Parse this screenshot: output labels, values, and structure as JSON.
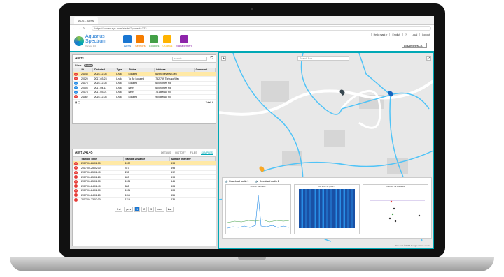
{
  "browser": {
    "tab_title": "AQS - Alerts",
    "url": "https://aquas-sys.com/alerts/?project=123"
  },
  "app": {
    "logo_line1": "Aquarius",
    "logo_line2": "Spectrum",
    "logo_sub": "Version 1.0",
    "modules": [
      {
        "label": "Alerts",
        "color": "#1976d2"
      },
      {
        "label": "Sensors",
        "color": "#f57c00"
      },
      {
        "label": "Couples",
        "color": "#43a047"
      },
      {
        "label": "Quarius",
        "color": "#ffb300"
      },
      {
        "label": "Management",
        "color": "#8e24aa"
      }
    ],
    "top_links": [
      "Hello mark_r",
      "English",
      "?",
      "Local",
      "Logout"
    ],
    "city": "LosAngelesCA"
  },
  "alerts_panel": {
    "title": "Alerts",
    "search_placeholder": "search",
    "filters_label": "Filters",
    "filter_pill": "Active",
    "columns": [
      "ID",
      "Detected",
      "Type",
      "Status",
      "Address",
      "Comment"
    ],
    "rows": [
      {
        "icon": "A",
        "color": "#e53935",
        "id": "24145",
        "detected": "2016-12-08",
        "type": "Leak",
        "status": "Located",
        "address": "619 N Beverly Glen"
      },
      {
        "icon": "A",
        "color": "#e53935",
        "id": "20020",
        "detected": "2017-03-23",
        "type": "Leak",
        "status": "To Be Located",
        "address": "752 759 Torbuso Way"
      },
      {
        "icon": "A",
        "color": "#1e88e5",
        "id": "24176",
        "detected": "2016-12-08",
        "type": "Leak",
        "status": "Located",
        "address": "600 Nimes Rd"
      },
      {
        "icon": "A",
        "color": "#1e88e5",
        "id": "20006",
        "detected": "2017-04-11",
        "type": "Leak",
        "status": "New",
        "address": "600 Nimes Rd"
      },
      {
        "icon": "A",
        "color": "#1e88e5",
        "id": "20174",
        "detected": "2017-03-01",
        "type": "Leak",
        "status": "New",
        "address": "761 Bel Air Rd"
      },
      {
        "icon": "A",
        "color": "#e53935",
        "id": "24162",
        "detected": "2016-12-08",
        "type": "Leak",
        "status": "Located",
        "address": "900 Bel Air Rd"
      }
    ],
    "total": "Total: 6"
  },
  "samples_panel": {
    "title": "Alert 24145",
    "tabs": [
      "DETAILS",
      "HISTORY",
      "FILES",
      "SAMPLES"
    ],
    "active_tab": "SAMPLES",
    "columns": [
      "Sample Time",
      "Sample Distance",
      "Sample Intensity"
    ],
    "rows": [
      [
        "2017-04-26 02:00",
        "1102",
        "598"
      ],
      [
        "2017-04-25 02:00",
        "473",
        "698"
      ],
      [
        "2017-04-25 02:40",
        "235",
        "692"
      ],
      [
        "2017-04-25 02:20",
        "653",
        "698"
      ],
      [
        "2017-04-25 02:00",
        "1106",
        "646"
      ],
      [
        "2017-04-24 02:40",
        "848",
        "604"
      ],
      [
        "2017-04-24 02:00",
        "1101",
        "608"
      ],
      [
        "2017-04-24 02:20",
        "1116",
        "655"
      ],
      [
        "2017-04-23 02:00",
        "1119",
        "635"
      ]
    ],
    "pager": [
      "first",
      "prev",
      "1",
      "2",
      "3",
      "next",
      "last"
    ],
    "active_page": "1"
  },
  "map": {
    "search_placeholder": "Search Box",
    "popup_links": [
      "Download audio 1",
      "Download audio 2"
    ],
    "chart_captions": [
      "FL 312 Sample...",
      "CL 1 10 11 (2017)",
      "Intensity vs Distance"
    ],
    "attribution": "Map data ©2017 Google  Terms of Use"
  }
}
